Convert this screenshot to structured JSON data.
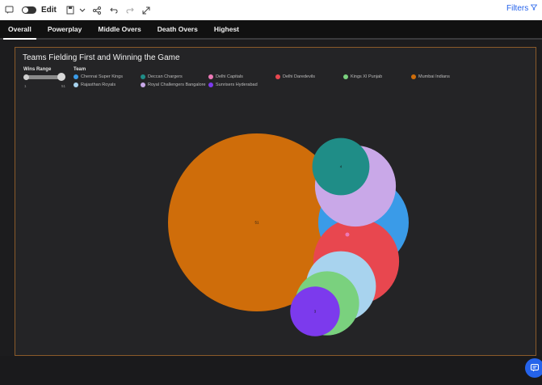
{
  "toolbar": {
    "edit_label": "Edit",
    "filters_label": "Filters"
  },
  "tabs": [
    {
      "label": "Overall",
      "active": true
    },
    {
      "label": "Powerplay",
      "active": false
    },
    {
      "label": "Middle Overs",
      "active": false
    },
    {
      "label": "Death Overs",
      "active": false
    },
    {
      "label": "Highest",
      "active": false
    }
  ],
  "panel": {
    "title": "Teams Fielding First and Winning the Game",
    "wins_range": {
      "label": "Wins Range",
      "min": "1",
      "max": "51"
    },
    "team_label": "Team"
  },
  "legend": [
    {
      "name": "Chennai Super Kings",
      "color": "#3a9be8"
    },
    {
      "name": "Deccan Chargers",
      "color": "#1f8d87"
    },
    {
      "name": "Delhi Capitals",
      "color": "#ec79b6"
    },
    {
      "name": "Delhi Daredevils",
      "color": "#e8474f"
    },
    {
      "name": "Kings XI Punjab",
      "color": "#7ad17e"
    },
    {
      "name": "Mumbai Indians",
      "color": "#cf6d0a"
    },
    {
      "name": "Rajasthan Royals",
      "color": "#a8d3ee"
    },
    {
      "name": "Royal Challengers Bangalore",
      "color": "#c9a8e8"
    },
    {
      "name": "Sunrisers Hyderabad",
      "color": "#7c3aed"
    }
  ],
  "chart_data": {
    "type": "bubble",
    "series": [
      {
        "team": "Mumbai Indians",
        "value": 51,
        "label": "51",
        "color": "#cf6d0a"
      },
      {
        "team": "Chennai Super Kings",
        "value": 10,
        "label": "10",
        "color": "#3a9be8"
      },
      {
        "team": "Delhi Daredevils",
        "value": 9,
        "label": "9",
        "color": "#e8474f"
      },
      {
        "team": "Royal Challengers Bangalore",
        "value": 8,
        "label": "8",
        "color": "#c9a8e8"
      },
      {
        "team": "Rajasthan Royals",
        "value": 6,
        "label": "6",
        "color": "#a8d3ee"
      },
      {
        "team": "Kings XI Punjab",
        "value": 5,
        "label": "5",
        "color": "#7ad17e"
      },
      {
        "team": "Deccan Chargers",
        "value": 4,
        "label": "4",
        "color": "#1f8d87"
      },
      {
        "team": "Sunrisers Hyderabad",
        "value": 3,
        "label": "3",
        "color": "#7c3aed"
      },
      {
        "team": "Delhi Capitals",
        "value": 1,
        "label": "",
        "color": "#ec79b6"
      }
    ]
  }
}
